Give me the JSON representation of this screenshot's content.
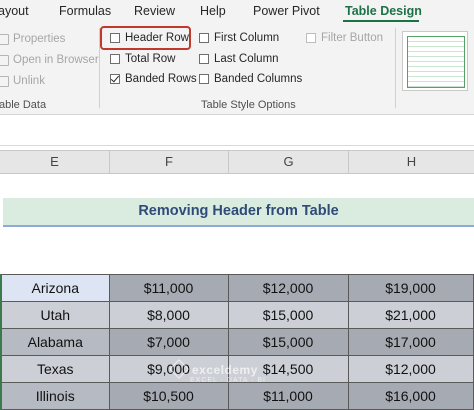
{
  "ribbon_tabs": [
    "ayout",
    "Formulas",
    "Review",
    "Help",
    "Power Pivot",
    "Table Design"
  ],
  "properties_group": {
    "properties": "Properties",
    "open_in_browser": "Open in Browser",
    "unlink": "Unlink",
    "label": "able Data"
  },
  "style_options": {
    "header_row": "Header Row",
    "total_row": "Total Row",
    "banded_rows": "Banded Rows",
    "first_column": "First Column",
    "last_column": "Last Column",
    "banded_columns": "Banded Columns",
    "filter_button": "Filter Button",
    "label": "Table Style Options",
    "header_row_checked": false,
    "total_row_checked": false,
    "banded_rows_checked": true,
    "first_column_checked": false,
    "last_column_checked": false,
    "banded_columns_checked": false,
    "filter_button_checked": false
  },
  "columns": [
    "E",
    "F",
    "G",
    "H"
  ],
  "sheet_title": "Removing Header from Table",
  "table_rows": [
    {
      "state": "Arizona",
      "f": "$11,000",
      "g": "$12,000",
      "h": "$19,000"
    },
    {
      "state": "Utah",
      "f": "$8,000",
      "g": "$15,000",
      "h": "$21,000"
    },
    {
      "state": "Alabama",
      "f": "$7,000",
      "g": "$15,000",
      "h": "$17,000"
    },
    {
      "state": "Texas",
      "f": "$9,000",
      "g": "$14,500",
      "h": "$12,000"
    },
    {
      "state": "Illinois",
      "f": "$10,500",
      "g": "$11,000",
      "h": "$16,000"
    }
  ],
  "watermark": {
    "name": "exceldemy",
    "tagline": "EXCEL · DATA · BI"
  },
  "colors": {
    "accent": "#1e7145",
    "highlight": "#c0392b",
    "title_text": "#2f4b78"
  }
}
